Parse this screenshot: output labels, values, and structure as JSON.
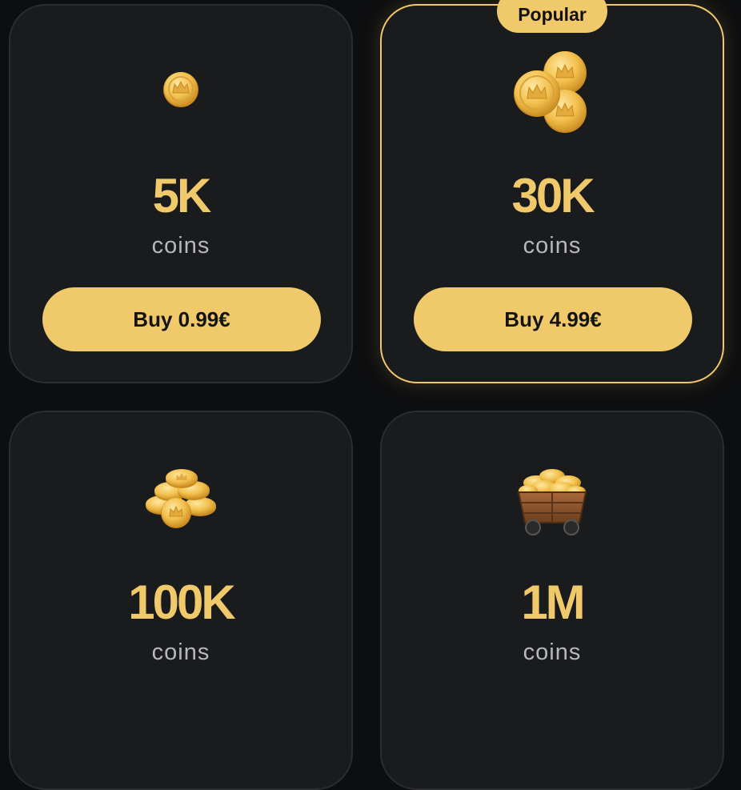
{
  "packs": [
    {
      "icon": "single-coin-icon",
      "amount": "5K",
      "unit": "coins",
      "button_label": "Buy 0.99€"
    },
    {
      "icon": "coin-stack-icon",
      "badge": "Popular",
      "amount": "30K",
      "unit": "coins",
      "button_label": "Buy 4.99€"
    },
    {
      "icon": "coin-pile-icon",
      "amount": "100K",
      "unit": "coins"
    },
    {
      "icon": "mine-cart-coins-icon",
      "amount": "1M",
      "unit": "coins"
    }
  ],
  "colors": {
    "background": "#0d0e10",
    "card": "#1a1b1d",
    "card_border": "#2b2c2f",
    "accent_gold": "#f0c96b",
    "muted_text": "#b7b8bb"
  }
}
